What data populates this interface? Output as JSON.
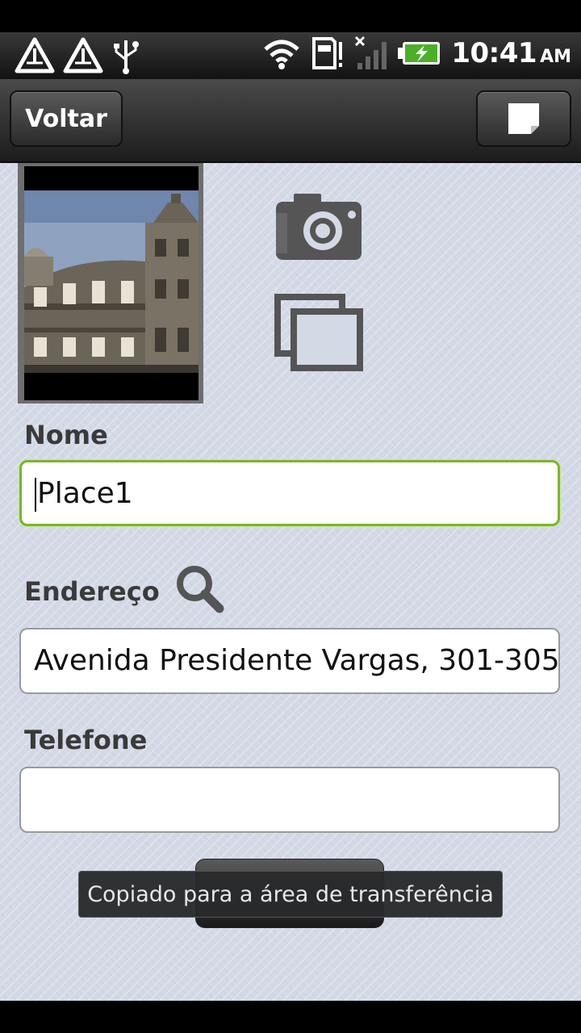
{
  "status_bar": {
    "time": "10:41",
    "ampm": "AM",
    "icons": [
      "warning-triangle-icon",
      "warning-triangle-icon",
      "usb-icon",
      "wifi-icon",
      "sd-card-icon",
      "signal-off-icon",
      "battery-charging-icon"
    ]
  },
  "action_bar": {
    "back_label": "Voltar",
    "note_icon": "note-icon"
  },
  "photo": {
    "camera_icon": "camera-icon",
    "gallery_icon": "gallery-icon"
  },
  "form": {
    "name_label": "Nome",
    "name_value": "Place1",
    "address_label": "Endereço",
    "address_value": "Avenida Presidente Vargas, 301-305",
    "phone_label": "Telefone",
    "phone_value": ""
  },
  "toast": {
    "message": "Copiado para a área de transferência"
  },
  "colors": {
    "focus_border": "#79b62b",
    "background": "#d4d9e6"
  }
}
